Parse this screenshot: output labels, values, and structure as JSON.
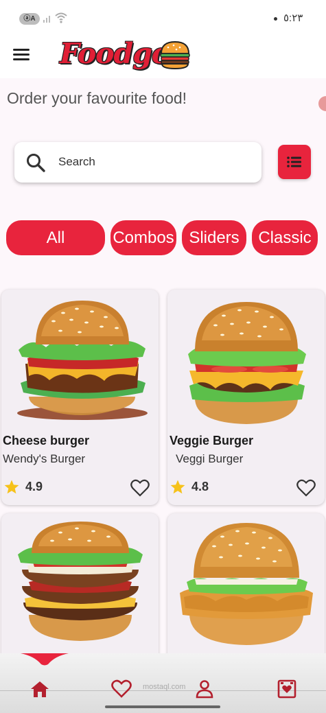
{
  "status_bar": {
    "badge": "ⓐA",
    "time": "٥:٢٣"
  },
  "app_bar": {
    "logo_text": "Foodgo"
  },
  "subtitle": "Order your favourite food!",
  "search": {
    "placeholder": "Search",
    "value": ""
  },
  "categories": [
    {
      "label": "All",
      "selected": true
    },
    {
      "label": "Combos",
      "selected": false
    },
    {
      "label": "Sliders",
      "selected": false
    },
    {
      "label": "Classic",
      "selected": false
    }
  ],
  "products": [
    {
      "name": "Cheese burger",
      "brand": "Wendy's Burger",
      "rating": "4.9",
      "image": "cheese-burger-image"
    },
    {
      "name": "Veggie Burger",
      "brand": "Veggi Burger",
      "rating": "4.8",
      "image": "veggie-burger-image"
    },
    {
      "name": "",
      "brand": "",
      "rating": "",
      "image": "double-burger-image"
    },
    {
      "name": "",
      "brand": "",
      "rating": "",
      "image": "chicken-burger-image"
    }
  ],
  "bottom_nav": [
    {
      "icon": "home-icon",
      "active": true
    },
    {
      "icon": "heart-icon",
      "active": false
    },
    {
      "icon": "profile-icon",
      "active": false
    },
    {
      "icon": "cart-icon",
      "active": false
    }
  ],
  "colors": {
    "accent": "#e8243d",
    "background": "#fdf7fb",
    "card": "#f3eef3",
    "nav_icon": "#b3202e",
    "star": "#f6c21a"
  }
}
